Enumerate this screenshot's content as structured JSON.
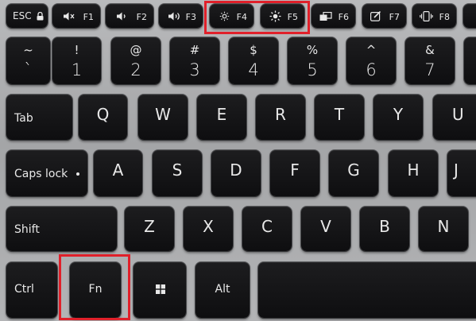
{
  "row_fn": [
    {
      "label": "ESC",
      "icon": "lock-icon"
    },
    {
      "fn": "F1",
      "icon": "speaker-mute-icon"
    },
    {
      "fn": "F2",
      "icon": "speaker-low-icon"
    },
    {
      "fn": "F3",
      "icon": "speaker-high-icon"
    },
    {
      "fn": "F4",
      "icon": "brightness-down-icon"
    },
    {
      "fn": "F5",
      "icon": "brightness-up-icon"
    },
    {
      "fn": "F6",
      "icon": "display-switch-icon"
    },
    {
      "fn": "F7",
      "icon": "screen-edit-icon"
    },
    {
      "fn": "F8",
      "icon": "phone-vibrate-icon"
    }
  ],
  "row_num": [
    {
      "top": "~",
      "bottom": "`"
    },
    {
      "top": "!",
      "bottom": "1"
    },
    {
      "top": "@",
      "bottom": "2"
    },
    {
      "top": "#",
      "bottom": "3"
    },
    {
      "top": "$",
      "bottom": "4"
    },
    {
      "top": "%",
      "bottom": "5"
    },
    {
      "top": "^",
      "bottom": "6"
    },
    {
      "top": "&",
      "bottom": "7"
    }
  ],
  "row_q": [
    "Tab",
    "Q",
    "W",
    "E",
    "R",
    "T",
    "Y",
    "U"
  ],
  "row_a": [
    "Caps lock",
    "A",
    "S",
    "D",
    "F",
    "G",
    "H",
    "J"
  ],
  "row_z": [
    "Shift",
    "Z",
    "X",
    "C",
    "V",
    "B",
    "N"
  ],
  "row_bottom": {
    "ctrl": "Ctrl",
    "fn": "Fn",
    "win_icon": "windows-logo-icon",
    "alt": "Alt"
  },
  "highlight_color": "#e0202a",
  "key_color": "#141416",
  "frame_color": "#aeafb1"
}
